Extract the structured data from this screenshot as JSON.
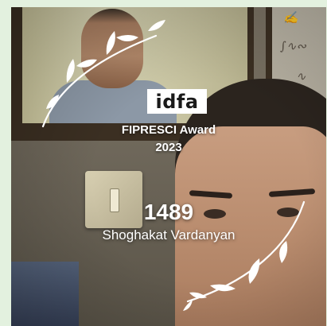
{
  "poster": {
    "festival_logo": "idfa",
    "award_name": "FIPRESCI Award",
    "award_year": "2023",
    "film_title": "1489",
    "director": "Shoghakat Vardanyan"
  },
  "icons": {
    "laurel": "laurel-wreath-icon"
  },
  "colors": {
    "page_background": "#e3f1df",
    "text": "#ffffff",
    "logo_background": "#ffffff"
  }
}
